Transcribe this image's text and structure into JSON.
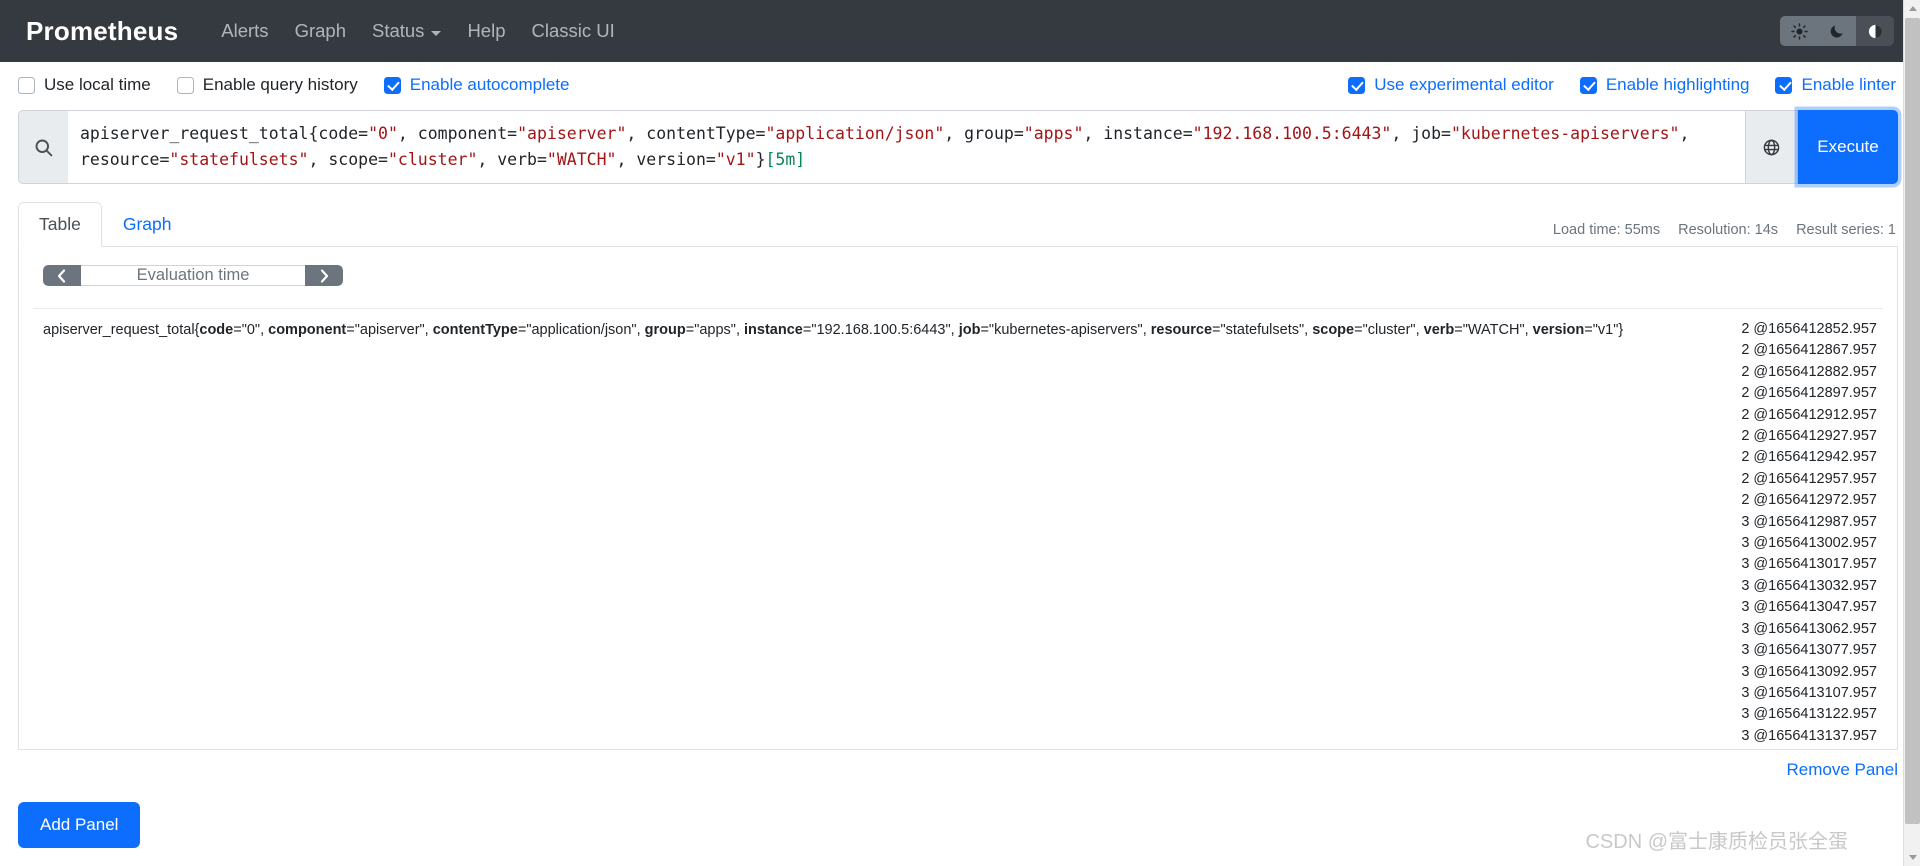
{
  "navbar": {
    "brand": "Prometheus",
    "links": [
      {
        "label": "Alerts",
        "icon": ""
      },
      {
        "label": "Graph",
        "icon": ""
      },
      {
        "label": "Status",
        "icon": "chevron-down-icon"
      },
      {
        "label": "Help",
        "icon": ""
      },
      {
        "label": "Classic UI",
        "icon": ""
      }
    ],
    "themes": [
      {
        "name": "sun-icon",
        "title": "Light theme",
        "active": false
      },
      {
        "name": "moon-icon",
        "title": "Dark theme",
        "active": false
      },
      {
        "name": "half-circle-icon",
        "title": "Auto theme",
        "active": true
      }
    ]
  },
  "options": {
    "left": [
      {
        "label": "Use local time",
        "checked": false
      },
      {
        "label": "Enable query history",
        "checked": false
      },
      {
        "label": "Enable autocomplete",
        "checked": true
      }
    ],
    "right": [
      {
        "label": "Use experimental editor",
        "checked": true
      },
      {
        "label": "Enable highlighting",
        "checked": true
      },
      {
        "label": "Enable linter",
        "checked": true
      }
    ]
  },
  "query": {
    "icon": "search-icon",
    "globe_icon": "globe-icon",
    "execute_label": "Execute",
    "expression": "apiserver_request_total{code=\"0\", component=\"apiserver\", contentType=\"application/json\", group=\"apps\", instance=\"192.168.100.5:6443\", job=\"kubernetes-apiservers\", resource=\"statefulsets\", scope=\"cluster\", verb=\"WATCH\", version=\"v1\"}[5m]",
    "tokens": [
      {
        "t": "apiserver_request_total{code=",
        "c": "plain"
      },
      {
        "t": "\"0\"",
        "c": "str"
      },
      {
        "t": ", component=",
        "c": "plain"
      },
      {
        "t": "\"apiserver\"",
        "c": "str"
      },
      {
        "t": ", contentType=",
        "c": "plain"
      },
      {
        "t": "\"application/json\"",
        "c": "str"
      },
      {
        "t": ", group=",
        "c": "plain"
      },
      {
        "t": "\"apps\"",
        "c": "str"
      },
      {
        "t": ", instance=",
        "c": "plain"
      },
      {
        "t": "\"192.168.100.5:6443\"",
        "c": "str"
      },
      {
        "t": ", job=",
        "c": "plain"
      },
      {
        "t": "\"kubernetes-apiservers\"",
        "c": "str"
      },
      {
        "t": ", resource=",
        "c": "plain"
      },
      {
        "t": "\"statefulsets\"",
        "c": "str"
      },
      {
        "t": ", scope=",
        "c": "plain"
      },
      {
        "t": "\"cluster\"",
        "c": "str"
      },
      {
        "t": ", verb=",
        "c": "plain"
      },
      {
        "t": "\"WATCH\"",
        "c": "str"
      },
      {
        "t": ", version=",
        "c": "plain"
      },
      {
        "t": "\"v1\"",
        "c": "str"
      },
      {
        "t": "}",
        "c": "plain"
      },
      {
        "t": "[5m]",
        "c": "dur"
      }
    ]
  },
  "panel": {
    "tabs": [
      {
        "label": "Table",
        "active": true
      },
      {
        "label": "Graph",
        "active": false
      }
    ],
    "meta": [
      "Load time: 55ms",
      "Resolution: 14s",
      "Result series: 1"
    ],
    "evaluation": {
      "prev_icon": "chevron-left-icon",
      "next_icon": "chevron-right-icon",
      "placeholder": "Evaluation time",
      "value": ""
    },
    "result": {
      "metric_name": "apiserver_request_total",
      "open_brace": "{",
      "close_brace": "}",
      "labels": [
        {
          "name": "code",
          "value": "\"0\"",
          "sep": "="
        },
        {
          "name": "component",
          "value": "\"apiserver\"",
          "sep": "="
        },
        {
          "name": "contentType",
          "value": "\"application/json\"",
          "sep": "="
        },
        {
          "name": "group",
          "value": "\"apps\"",
          "sep": "="
        },
        {
          "name": "instance",
          "value": "\"192.168.100.5:6443\"",
          "sep": "="
        },
        {
          "name": "job",
          "value": "\"kubernetes-apiservers\"",
          "sep": "="
        },
        {
          "name": "resource",
          "value": "\"statefulsets\"",
          "sep": "="
        },
        {
          "name": "scope",
          "value": "\"cluster\"",
          "sep": "="
        },
        {
          "name": "verb",
          "value": "\"WATCH\"",
          "sep": "="
        },
        {
          "name": "version",
          "value": "\"v1\"",
          "sep": "="
        }
      ],
      "samples": [
        "2 @1656412852.957",
        "2 @1656412867.957",
        "2 @1656412882.957",
        "2 @1656412897.957",
        "2 @1656412912.957",
        "2 @1656412927.957",
        "2 @1656412942.957",
        "2 @1656412957.957",
        "2 @1656412972.957",
        "3 @1656412987.957",
        "3 @1656413002.957",
        "3 @1656413017.957",
        "3 @1656413032.957",
        "3 @1656413047.957",
        "3 @1656413062.957",
        "3 @1656413077.957",
        "3 @1656413092.957",
        "3 @1656413107.957",
        "3 @1656413122.957",
        "3 @1656413137.957"
      ]
    },
    "remove_panel_label": "Remove Panel"
  },
  "footer": {
    "add_panel_label": "Add Panel",
    "watermark": "CSDN @富士康质检员张全蛋"
  },
  "colors": {
    "navbar_bg": "#343a40",
    "accent": "#0d6efd",
    "string_token": "#a31515",
    "duration_token": "#098658",
    "muted": "#6c757d"
  }
}
